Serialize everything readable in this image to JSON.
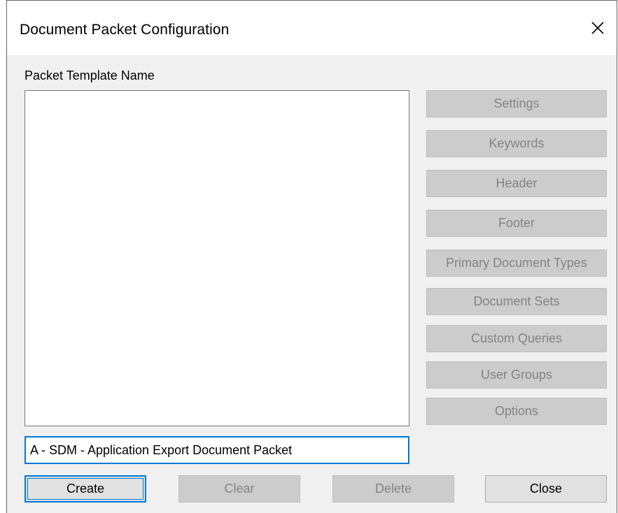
{
  "window": {
    "title": "Document Packet Configuration"
  },
  "form": {
    "list_label": "Packet Template Name",
    "name_value": "A - SDM - Application Export Document Packet"
  },
  "side_buttons": [
    {
      "label": "Settings",
      "state": "disabled"
    },
    {
      "label": "Keywords",
      "state": "disabled"
    },
    {
      "label": "Header",
      "state": "disabled"
    },
    {
      "label": "Footer",
      "state": "disabled"
    },
    {
      "label": "Primary Document Types",
      "state": "disabled"
    },
    {
      "label": "Document Sets",
      "state": "disabled"
    },
    {
      "label": "Custom Queries",
      "state": "disabled"
    },
    {
      "label": "User Groups",
      "state": "disabled"
    },
    {
      "label": "Options",
      "state": "disabled"
    }
  ],
  "bottom_buttons": {
    "create": "Create",
    "clear": "Clear",
    "delete": "Delete",
    "close": "Close"
  },
  "colors": {
    "accent": "#0078d7",
    "disabled_text": "#838383",
    "disabled_bg": "#cccccc",
    "dialog_bg": "#f0f0f0"
  },
  "icons": {
    "close": "close-icon"
  }
}
